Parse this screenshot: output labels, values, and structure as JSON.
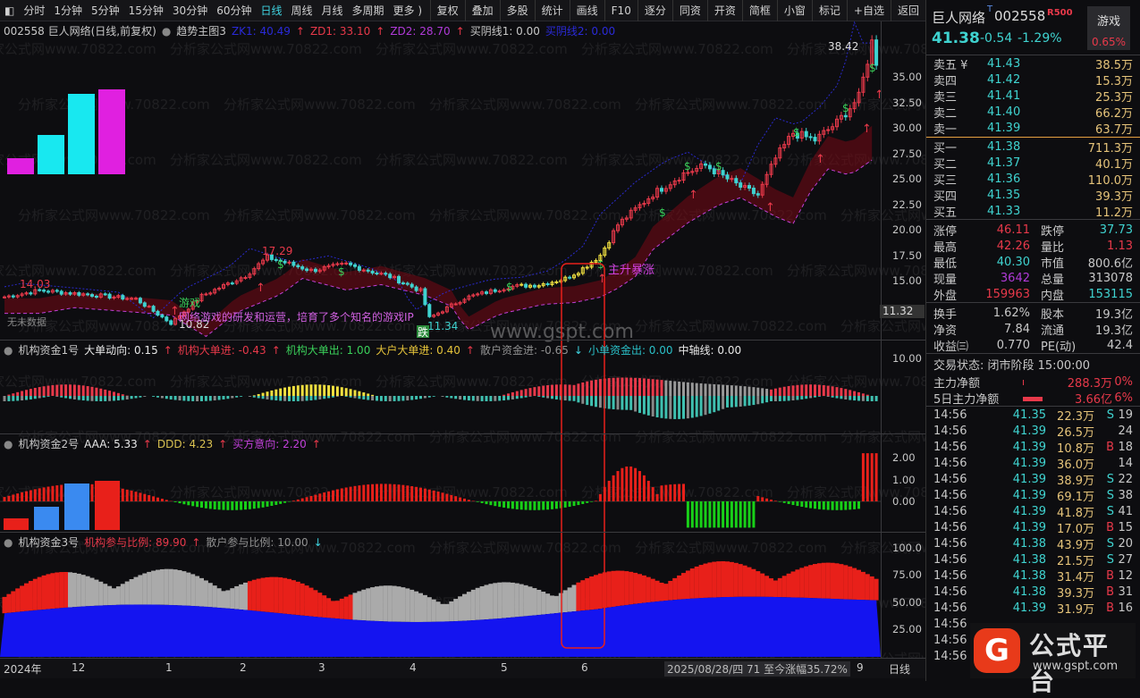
{
  "toolbar": {
    "periods": [
      "分时",
      "1分钟",
      "5分钟",
      "15分钟",
      "30分钟",
      "60分钟",
      "日线",
      "周线",
      "月线",
      "多周期",
      "更多 )"
    ],
    "active": "日线",
    "actions": [
      "复权",
      "叠加",
      "多股",
      "统计",
      "画线",
      "F10",
      "逐分",
      "同资",
      "开资",
      "简框",
      "小窗",
      "标记",
      "+自选",
      "返回"
    ]
  },
  "main": {
    "title": "002558 巨人网络(日线,前复权)",
    "indicator": "趋势主图3",
    "zk1": "ZK1: 40.49",
    "zd1": "ZD1: 33.10",
    "zd2": "ZD2: 28.70",
    "myx1": "买阴线1: 0.00",
    "myx2": "买阴线2: 0.00",
    "labels": {
      "high1": "14.03",
      "low1": "10.82",
      "high2": "17.29",
      "low2": "11.34",
      "max": "38.42",
      "topic": "游戏",
      "desc": "网络游戏的研发和运营，培育了多个知名的游戏IP",
      "nodata": "无未数据",
      "die": "跌",
      "boom": "主升暴涨",
      "current": "11.32",
      "watermark": "www.gspt.com",
      "wm70822": "分析家公式网www.70822.com"
    },
    "axis": [
      "35.00",
      "32.50",
      "30.00",
      "27.50",
      "25.00",
      "22.50",
      "20.00",
      "17.50",
      "15.00"
    ]
  },
  "chart_data": {
    "type": "candlestick",
    "x_unit": "trading day",
    "keypoints": [
      [
        0,
        13.4
      ],
      [
        8,
        14.03
      ],
      [
        20,
        13.6
      ],
      [
        30,
        13.2
      ],
      [
        38,
        10.82
      ],
      [
        45,
        13.5
      ],
      [
        55,
        15.5
      ],
      [
        60,
        17.29
      ],
      [
        70,
        16.0
      ],
      [
        78,
        16.6
      ],
      [
        88,
        15.4
      ],
      [
        95,
        14.0
      ],
      [
        97,
        11.34
      ],
      [
        105,
        13.3
      ],
      [
        115,
        14.4
      ],
      [
        122,
        14.6
      ],
      [
        128,
        15.2
      ],
      [
        132,
        16.2
      ],
      [
        136,
        17.5
      ],
      [
        140,
        20.5
      ],
      [
        148,
        23.5
      ],
      [
        155,
        25.5
      ],
      [
        160,
        26.3
      ],
      [
        168,
        24.2
      ],
      [
        172,
        23.4
      ],
      [
        176,
        27.0
      ],
      [
        180,
        29.5
      ],
      [
        185,
        28.8
      ],
      [
        190,
        30.5
      ],
      [
        195,
        33.0
      ],
      [
        198,
        38.42
      ],
      [
        199,
        36.5
      ]
    ]
  },
  "panel1": {
    "name": "机构资金1号",
    "items": [
      {
        "t": "大单动向: 0.15",
        "c": "#e8e8e8",
        "arrow": "↑"
      },
      {
        "t": "机构大单进: -0.43",
        "c": "#e8394a",
        "arrow": "↑"
      },
      {
        "t": "机构大单出: 1.00",
        "c": "#3ad05a",
        "arrow": ""
      },
      {
        "t": "大户大单进: 0.40",
        "c": "#e6c43a",
        "arrow": "↑"
      },
      {
        "t": "散户资金进: -0.65",
        "c": "#909090",
        "arrow": "↓"
      },
      {
        "t": "小单资金出: 0.00",
        "c": "#2ac0c8",
        "arrow": ""
      },
      {
        "t": "中轴线: 0.00",
        "c": "#e8e8e8",
        "arrow": ""
      }
    ],
    "axis": [
      "10.00"
    ]
  },
  "panel2": {
    "name": "机构资金2号",
    "items": [
      {
        "t": "AAA: 5.33",
        "c": "#e8e8e8",
        "arrow": "↑"
      },
      {
        "t": "DDD: 4.23",
        "c": "#d8c050",
        "arrow": "↑"
      },
      {
        "t": "买方意向: 2.20",
        "c": "#c040d8",
        "arrow": "↑"
      }
    ],
    "axis": [
      "2.00",
      "1.00",
      "0.00"
    ]
  },
  "panel3": {
    "name": "机构资金3号",
    "items": [
      {
        "t": "机构参与比例: 89.90",
        "c": "#e8394a",
        "arrow": "↑"
      },
      {
        "t": "散户参与比例: 10.00",
        "c": "#909090",
        "arrow": "↓"
      }
    ],
    "axis": [
      "100.0",
      "75.00",
      "50.00",
      "25.00"
    ]
  },
  "dates": {
    "labels": [
      "2024年",
      "12",
      "1",
      "2",
      "3",
      "4",
      "5",
      "6",
      "9"
    ],
    "info": "2025/08/28/四 71 至今涨幅35.72%",
    "period": "日线"
  },
  "quote": {
    "name": "巨人网络",
    "code": "002558",
    "tag": "R500",
    "sector": "游戏",
    "sector_pct": "0.65%",
    "price": "41.38",
    "chg": "-0.54",
    "pct": "-1.29%",
    "asks": [
      [
        "卖五 ¥",
        "41.43",
        "38.5万"
      ],
      [
        "卖四",
        "41.42",
        "15.3万"
      ],
      [
        "卖三",
        "41.41",
        "25.3万"
      ],
      [
        "卖二",
        "41.40",
        "66.2万"
      ],
      [
        "卖一",
        "41.39",
        "63.7万"
      ]
    ],
    "bids": [
      [
        "买一",
        "41.38",
        "711.3万"
      ],
      [
        "买二",
        "41.37",
        "40.1万"
      ],
      [
        "买三",
        "41.36",
        "110.0万"
      ],
      [
        "买四",
        "41.35",
        "39.3万"
      ],
      [
        "买五",
        "41.33",
        "11.2万"
      ]
    ],
    "stats": [
      [
        "涨停",
        "46.11",
        "rd",
        "跌停",
        "37.73",
        "cy"
      ],
      [
        "最高",
        "42.26",
        "rd",
        "量比",
        "1.13",
        "rd"
      ],
      [
        "最低",
        "40.30",
        "cy",
        "市值",
        "800.6亿",
        "wh"
      ],
      [
        "现量",
        "3642",
        "pp",
        "总量",
        "313078",
        "wh"
      ],
      [
        "外盘",
        "159963",
        "rd",
        "内盘",
        "153115",
        "cy"
      ]
    ],
    "fund": [
      [
        "换手",
        "1.62%",
        "股本",
        "19.3亿"
      ],
      [
        "净资",
        "7.84",
        "流通",
        "19.3亿"
      ],
      [
        "收益㈢",
        "0.770",
        "PE(动)",
        "42.4"
      ]
    ],
    "status": "交易状态: 闭市阶段 15:00:00",
    "flow": [
      [
        "主力净额",
        "288.3万",
        "0%"
      ],
      [
        "5日主力净额",
        "3.66亿",
        "6%"
      ]
    ],
    "ticks": [
      [
        "14:56",
        "41.35",
        "22.3万",
        "S",
        "19"
      ],
      [
        "14:56",
        "41.39",
        "26.5万",
        "",
        "24"
      ],
      [
        "14:56",
        "41.39",
        "10.8万",
        "B",
        "18"
      ],
      [
        "14:56",
        "41.39",
        "36.0万",
        "",
        "14"
      ],
      [
        "14:56",
        "41.39",
        "38.9万",
        "S",
        "22"
      ],
      [
        "14:56",
        "41.39",
        "69.1万",
        "S",
        "38"
      ],
      [
        "14:56",
        "41.39",
        "41.8万",
        "S",
        "41"
      ],
      [
        "14:56",
        "41.39",
        "17.0万",
        "B",
        "15"
      ],
      [
        "14:56",
        "41.38",
        "43.9万",
        "S",
        "20"
      ],
      [
        "14:56",
        "41.38",
        "21.5万",
        "S",
        "27"
      ],
      [
        "14:56",
        "41.38",
        "31.4万",
        "B",
        "12"
      ],
      [
        "14:56",
        "41.38",
        "39.3万",
        "B",
        "31"
      ],
      [
        "14:56",
        "41.39",
        "31.9万",
        "B",
        "16"
      ],
      [
        "14:56",
        "",
        "",
        "",
        ""
      ],
      [
        "14:56",
        "",
        "",
        "",
        ""
      ],
      [
        "14:56",
        "",
        "",
        "",
        ""
      ]
    ]
  },
  "logo": {
    "text": "公式平台",
    "url": "www.gspt.com"
  },
  "colors": {
    "up": "#e8394a",
    "down": "#3fd3d0",
    "yellow": "#f0e040",
    "blue": "#1a1aff"
  }
}
